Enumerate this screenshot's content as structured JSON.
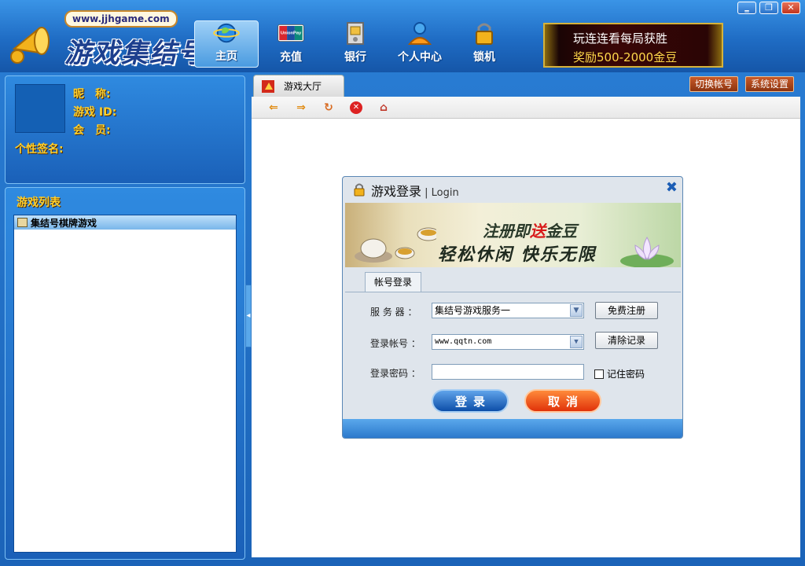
{
  "header": {
    "site_url": "www.jjhgame.com",
    "logo_text": "游戏集结号",
    "nav": [
      {
        "label": "主页",
        "icon": "globe-icon",
        "active": true
      },
      {
        "label": "充值",
        "icon": "unionpay-card-icon",
        "card_text": "UnionPay 银联"
      },
      {
        "label": "银行",
        "icon": "bank-icon"
      },
      {
        "label": "个人中心",
        "icon": "user-center-icon"
      },
      {
        "label": "锁机",
        "icon": "padlock-icon"
      }
    ],
    "promo": {
      "line1": "玩连连看每局获胜",
      "line2": "奖励500-2000金豆"
    },
    "window_buttons": {
      "minimize": "‗",
      "restore": "❐",
      "close": "✕"
    }
  },
  "user": {
    "nickname_label": "昵　称:",
    "game_id_label": "游戏 ID:",
    "member_label": "会　员:",
    "signature_label": "个性签名:"
  },
  "game_list": {
    "title": "游戏列表",
    "items": [
      "集结号棋牌游戏"
    ]
  },
  "tabs": {
    "active": "游戏大厅"
  },
  "top_buttons": {
    "switch_account": "切换帐号",
    "settings": "系统设置"
  },
  "toolbar": [
    "back-icon",
    "forward-icon",
    "refresh-icon",
    "stop-icon",
    "home-icon"
  ],
  "dialog": {
    "title": "游戏登录",
    "title_sub": " | Login",
    "banner_line1_a": "注册即",
    "banner_line1_red": "送",
    "banner_line1_b": "金豆",
    "banner_line2": "轻松休闲 快乐无限",
    "tab_label": "帐号登录",
    "server_label": "服 务 器 ：",
    "server_value": "集结号游戏服务一",
    "account_label": "登录帐号 ：",
    "account_value": "www.qqtn.com",
    "password_label": "登录密码 ：",
    "register_btn": "免费注册",
    "clear_btn": "清除记录",
    "remember_label": "记住密码",
    "remember_checked": false,
    "login_btn": "登录",
    "cancel_btn": "取消"
  },
  "colors": {
    "brand_blue": "#1f6cc4",
    "gold": "#ffcf2a",
    "cancel_orange": "#e0320a"
  }
}
